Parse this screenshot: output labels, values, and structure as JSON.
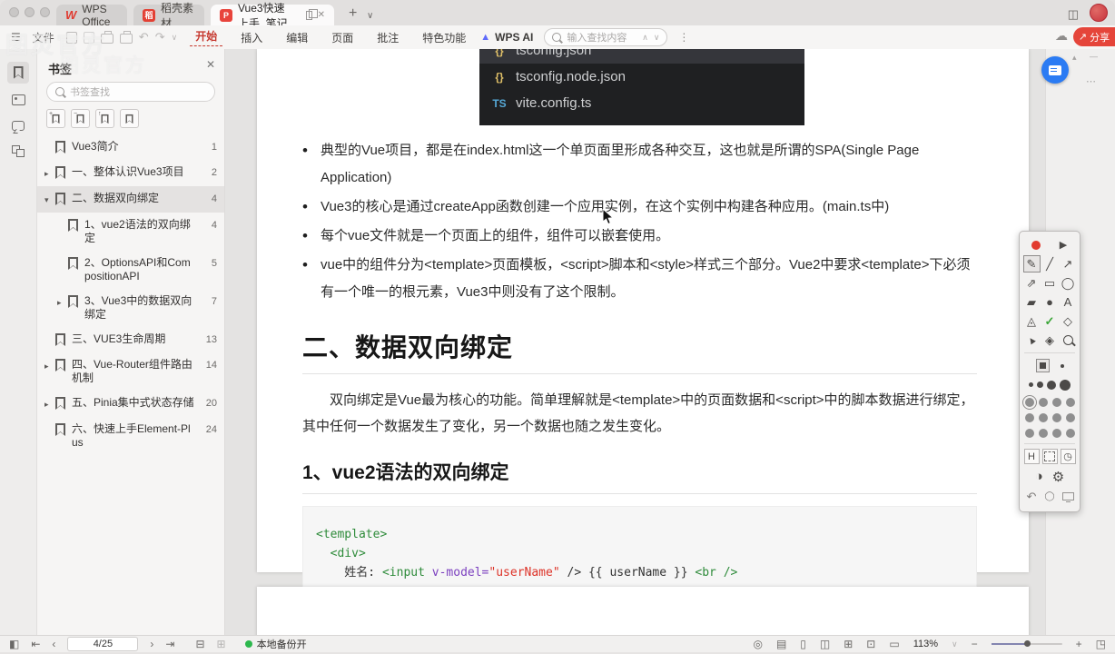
{
  "titlebar": {
    "tabs": [
      {
        "label": "WPS Office"
      },
      {
        "label": "稻壳素材"
      },
      {
        "label": "Vue3快速上手_笔记"
      }
    ],
    "new_tab": "+",
    "tab_list": "∨"
  },
  "toolbar": {
    "file_label": "文件",
    "menus": [
      {
        "label": "开始"
      },
      {
        "label": "插入"
      },
      {
        "label": "编辑"
      },
      {
        "label": "页面"
      },
      {
        "label": "批注"
      },
      {
        "label": "特色功能"
      }
    ],
    "wps_ai": "WPS AI",
    "search_placeholder": "输入查找内容",
    "share_label": "分享"
  },
  "watermark": {
    "text": "图灵官方"
  },
  "sidebar": {
    "panel_title": "书签",
    "search_placeholder": "书签查找",
    "bookmarks": [
      {
        "label": "Vue3简介",
        "page": "1"
      },
      {
        "label": "一、整体认识Vue3项目",
        "page": "2"
      },
      {
        "label": "二、数据双向绑定",
        "page": "4"
      },
      {
        "label": "1、vue2语法的双向绑定",
        "page": "4"
      },
      {
        "label": "2、OptionsAPI和CompositionAPI",
        "page": "5"
      },
      {
        "label": "3、Vue3中的数据双向绑定",
        "page": "7"
      },
      {
        "label": "三、VUE3生命周期",
        "page": "13"
      },
      {
        "label": "四、Vue-Router组件路由机制",
        "page": "14"
      },
      {
        "label": "五、Pinia集中式状态存储",
        "page": "20"
      },
      {
        "label": "六、快速上手Element-Plus",
        "page": "24"
      }
    ]
  },
  "document": {
    "explorer_files": [
      {
        "name": "tsconfig.json"
      },
      {
        "name": "tsconfig.node.json"
      },
      {
        "name": "vite.config.ts"
      }
    ],
    "explorer_icons": {
      "json": "{}",
      "ts": "TS"
    },
    "bullets": [
      "典型的Vue项目，都是在index.html这一个单页面里形成各种交互，这也就是所谓的SPA(Single Page Application)",
      "Vue3的核心是通过createApp函数创建一个应用实例，在这个实例中构建各种应用。(main.ts中)",
      "每个vue文件就是一个页面上的组件，组件可以嵌套使用。",
      "vue中的组件分为<template>页面模板，<script>脚本和<style>样式三个部分。Vue2中要求<template>下必须有一个唯一的根元素，Vue3中则没有了这个限制。"
    ],
    "h1": "二、数据双向绑定",
    "para": "双向绑定是Vue最为核心的功能。简单理解就是<template>中的页面数据和<script>中的脚本数据进行绑定，其中任何一个数据发生了变化，另一个数据也随之发生变化。",
    "h2": "1、vue2语法的双向绑定",
    "code": {
      "l1": "<template>",
      "l2": "  <div>",
      "l3_pre": "    姓名: ",
      "l3_tag": "<input",
      "l3_attr": " v-model=",
      "l3_str": "\"userName\"",
      "l3_mid": " /> ",
      "l3_expr": "{{ userName }}",
      "l3_tag2": " <br />"
    }
  },
  "statusbar": {
    "page_indicator": "4/25",
    "backup_label": "本地备份开",
    "zoom_level": "113%"
  },
  "icons": {
    "hamburger": "☰",
    "undo": "↶",
    "redo": "↷",
    "chev_down": "∨",
    "chev_up": "∧",
    "more_vert": "⋮",
    "close": "✕",
    "share_arrow": "↗",
    "cloud": "☁",
    "reader_layout": "◫",
    "wps_ai_logo": "▲",
    "play": "▶",
    "line": "╱",
    "arrow_ne": "↗",
    "arrow_ne2": "⇗",
    "pen": "✎",
    "rect": "▭",
    "ellipse": "◯",
    "rect_fill": "▰",
    "circle_fill": "●",
    "text_tool": "A",
    "shape": "◬",
    "check": "✓",
    "diamond": "◇",
    "cursor_tool": "▲",
    "eraser": "◈",
    "clock": "◷",
    "contrast": "◑",
    "gear": "⚙",
    "h_button": "H",
    "circle_o": "◯",
    "tri_up": "▴",
    "dots_h": "⋯",
    "dash": "—",
    "sb_sidebar": "◧",
    "sb_first": "⇤",
    "sb_prev": "‹",
    "sb_next": "›",
    "sb_last": "⇥",
    "sb_sq1": "⊟",
    "sb_sq2": "⊞",
    "sb_eye": "◎",
    "sb_book": "▤",
    "sb_single": "▯",
    "sb_double": "◫",
    "sb_grid": "⊞",
    "sb_fit": "⊡",
    "sb_page": "▭",
    "sb_minus": "−",
    "sb_plus": "+",
    "sb_expand": "◳"
  }
}
